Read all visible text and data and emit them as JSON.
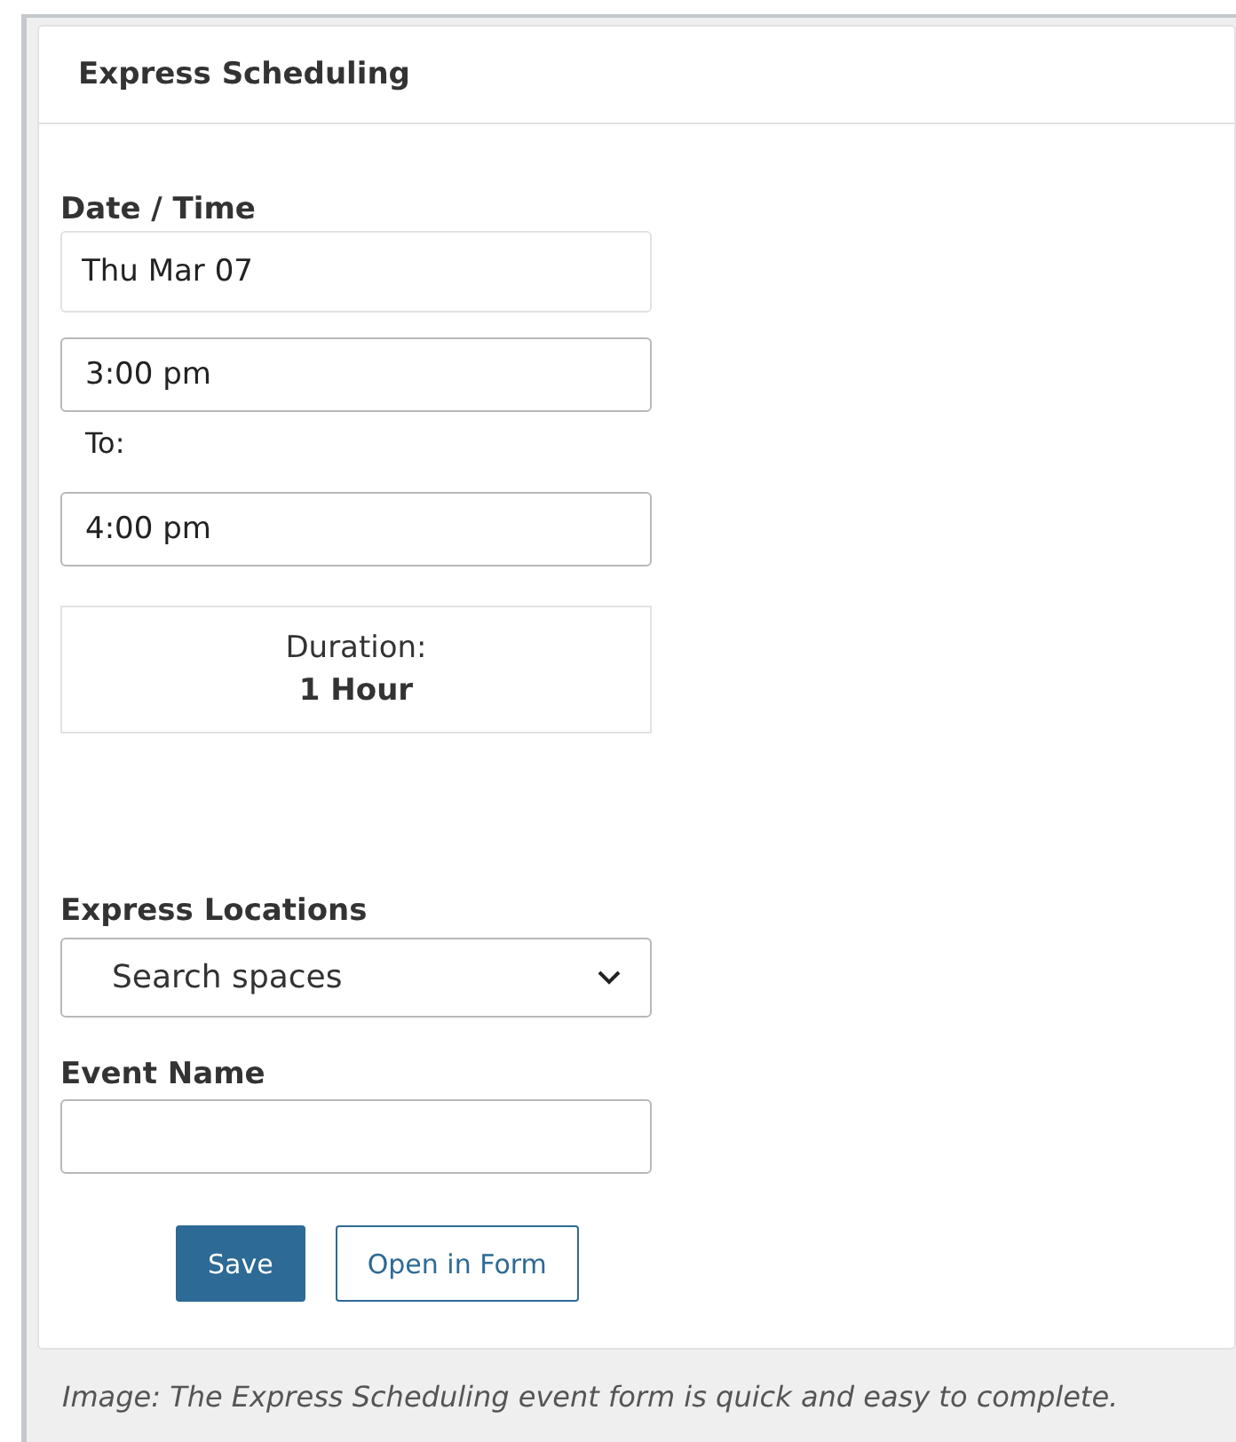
{
  "panel": {
    "title": "Express Scheduling"
  },
  "date_time": {
    "label": "Date / Time",
    "date": "Thu Mar 07",
    "start": "3:00 pm",
    "to_label": "To:",
    "end": "4:00 pm",
    "duration_label": "Duration:",
    "duration": "1 Hour"
  },
  "locations": {
    "label": "Express Locations",
    "placeholder": "Search spaces"
  },
  "event_name": {
    "label": "Event Name"
  },
  "buttons": [
    {
      "label": "Save",
      "kind": "primary"
    },
    {
      "label": "Open in Form",
      "kind": "outline"
    }
  ],
  "caption": "Image: The Express Scheduling event form is quick and easy to complete."
}
